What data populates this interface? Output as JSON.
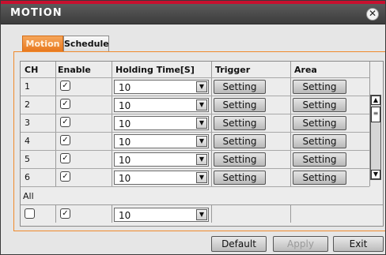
{
  "window": {
    "title": "MOTION",
    "close_glyph": "✕"
  },
  "tabs": [
    {
      "label": "Motion",
      "active": true
    },
    {
      "label": "Schedule",
      "active": false
    }
  ],
  "table": {
    "headers": {
      "ch": "CH",
      "enable": "Enable",
      "holding": "Holding Time[S]",
      "trigger": "Trigger",
      "area": "Area"
    },
    "rows": [
      {
        "ch": "1",
        "enable": true,
        "holding": "10",
        "trigger": "Setting",
        "area": "Setting"
      },
      {
        "ch": "2",
        "enable": true,
        "holding": "10",
        "trigger": "Setting",
        "area": "Setting"
      },
      {
        "ch": "3",
        "enable": true,
        "holding": "10",
        "trigger": "Setting",
        "area": "Setting"
      },
      {
        "ch": "4",
        "enable": true,
        "holding": "10",
        "trigger": "Setting",
        "area": "Setting"
      },
      {
        "ch": "5",
        "enable": true,
        "holding": "10",
        "trigger": "Setting",
        "area": "Setting"
      },
      {
        "ch": "6",
        "enable": true,
        "holding": "10",
        "trigger": "Setting",
        "area": "Setting"
      }
    ],
    "all_label": "All",
    "all_row": {
      "select": false,
      "enable": true,
      "holding": "10"
    }
  },
  "footer": {
    "default": "Default",
    "apply": "Apply",
    "exit": "Exit"
  },
  "colors": {
    "accent": "#e8781e",
    "title_bar": "#4a4a4a",
    "top_line": "#c8102e"
  },
  "icons": {
    "check": "✓",
    "dropdown": "▼",
    "scroll_up": "▲",
    "scroll_down": "▼",
    "scroll_grip": "≡"
  }
}
